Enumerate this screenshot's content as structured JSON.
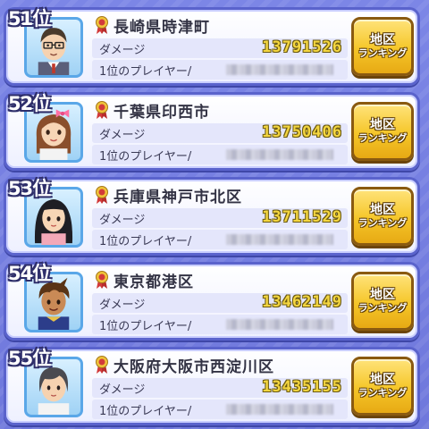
{
  "colors": {
    "background": "#7c86e6",
    "card_border": "#5a63cc",
    "damage_text": "#f4d640",
    "button_gold": "#f5c628"
  },
  "labels": {
    "damage": "ダメージ",
    "top_player": "1位のプレイヤー/",
    "btn_line1": "地区",
    "btn_line2": "ランキング"
  },
  "entries": [
    {
      "rank": "51位",
      "area": "長崎県時津町",
      "damage": "13791526",
      "avatar": "glasses-man-avatar-icon"
    },
    {
      "rank": "52位",
      "area": "千葉県印西市",
      "damage": "13750406",
      "avatar": "girl-pink-bow-avatar-icon"
    },
    {
      "rank": "53位",
      "area": "兵庫県神戸市北区",
      "damage": "13711529",
      "avatar": "black-hair-girl-avatar-icon"
    },
    {
      "rank": "54位",
      "area": "東京都港区",
      "damage": "13462149",
      "avatar": "boy-brown-hair-avatar-icon"
    },
    {
      "rank": "55位",
      "area": "大阪府大阪市西淀川区",
      "damage": "13435155",
      "avatar": "short-hair-woman-avatar-icon"
    }
  ]
}
